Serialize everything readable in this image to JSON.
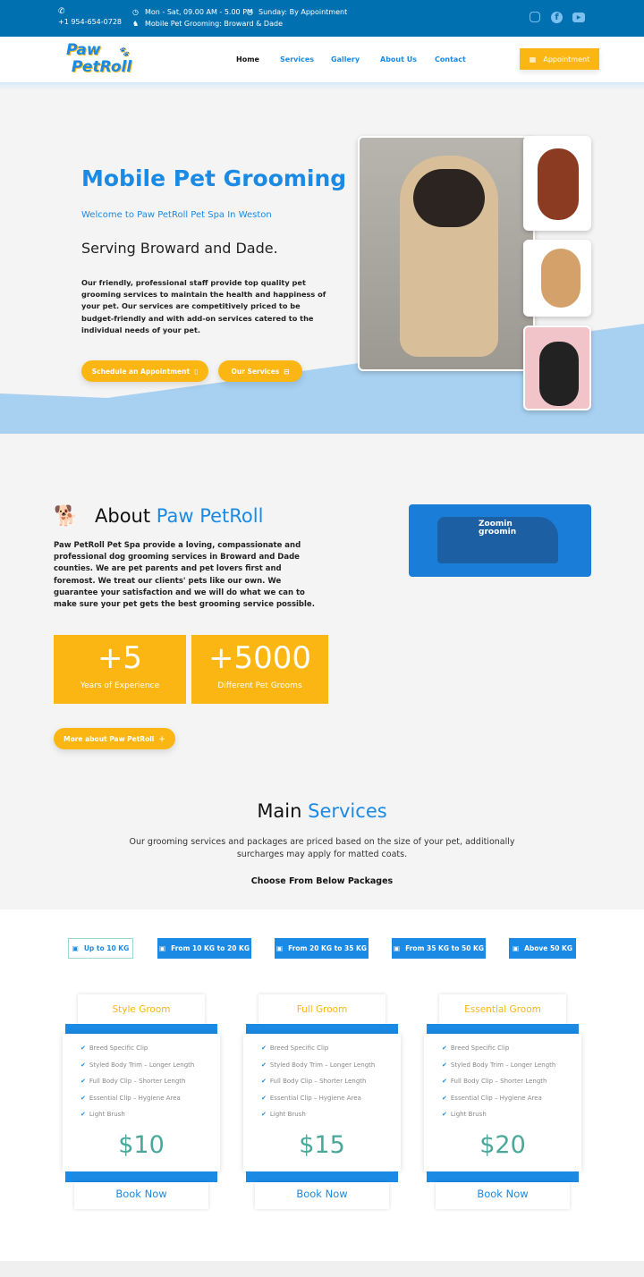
{
  "topbar": {
    "phone": "+1 954-654-0728",
    "hours": "Mon - Sat, 09.00 AM - 5.00 PM",
    "sunday": "Sunday: By Appointment",
    "area": "Mobile Pet Grooming: Broward & Dade",
    "social": [
      "instagram-icon",
      "facebook-icon",
      "youtube-icon"
    ]
  },
  "nav": {
    "logo_text": "Paw PetRoll",
    "links": [
      "Home",
      "Services",
      "Gallery",
      "About Us",
      "Contact"
    ],
    "appointment": "Appointment"
  },
  "hero": {
    "title": "Mobile Pet Grooming",
    "subtitle": "Welcome to Paw PetRoll Pet Spa In Weston",
    "serving": "Serving Broward and Dade.",
    "body": "Our friendly, professional staff provide top quality pet grooming services to maintain the health and happiness of your pet. Our services are competitively priced to be budget-friendly and with add-on services catered to the individual needs of your pet.",
    "btn_schedule": "Schedule an Appointment",
    "btn_services": "Our Services"
  },
  "about": {
    "title_a": "About ",
    "title_b": "Paw PetRoll",
    "body": "Paw PetRoll Pet Spa provide a loving, compassionate and professional dog grooming services in Broward and Dade counties. We are pet parents and pet lovers first and foremost. We treat our clients' pets like our own. We guarantee your satisfaction and we will do what we can to make sure your pet gets the best grooming service possible.",
    "stats": [
      {
        "n": "+5",
        "l": "Years of Experience"
      },
      {
        "n": "+5000",
        "l": "Different Pet Grooms"
      }
    ],
    "more": "More about Paw PetRoll",
    "van_text": "Zoomin groomin"
  },
  "services": {
    "title_a": "Main ",
    "title_b": "Services",
    "desc": "Our grooming services and packages are priced based on the size of your pet, additionally surcharges may apply for matted coats.",
    "choose": "Choose From Below Packages",
    "tabs": [
      "Up to 10 KG",
      "From 10 KG to 20 KG",
      "From 20 KG to 35 KG",
      "From 35 KG to 50 KG",
      "Above 50 KG"
    ],
    "active_tab": 0,
    "features": [
      "Breed Specific Clip",
      "Styled Body Trim – Longer Length",
      "Full Body Clip – Shorter Length",
      "Essential Clip – Hygiene Area",
      "Light Brush"
    ],
    "packages": [
      {
        "name": "Style Groom",
        "price": "$10"
      },
      {
        "name": "Full Groom",
        "price": "$15"
      },
      {
        "name": "Essential Groom",
        "price": "$20"
      }
    ],
    "book": "Book Now"
  },
  "colors": {
    "primary": "#1a8ae5",
    "topbar": "#0070b0",
    "accent": "#fbb614",
    "price": "#4aa89a"
  }
}
